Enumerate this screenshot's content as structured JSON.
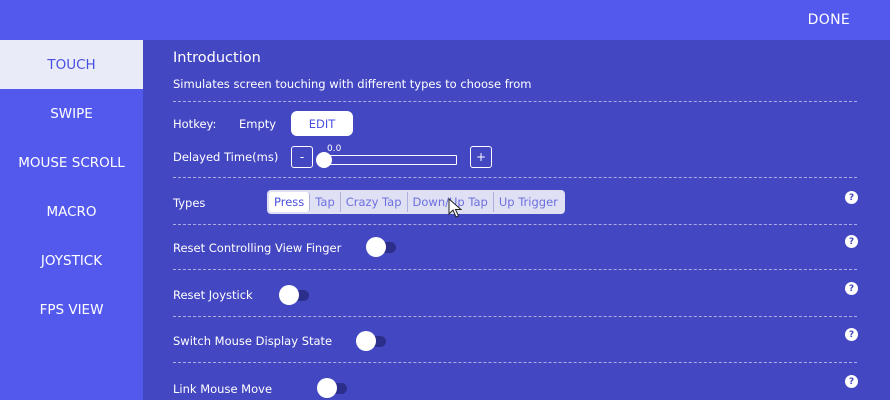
{
  "header": {
    "done_label": "DONE"
  },
  "sidebar": {
    "items": [
      {
        "label": "TOUCH",
        "active": true
      },
      {
        "label": "SWIPE"
      },
      {
        "label": "MOUSE SCROLL"
      },
      {
        "label": "MACRO"
      },
      {
        "label": "JOYSTICK"
      },
      {
        "label": "FPS VIEW"
      }
    ]
  },
  "intro": {
    "title": "Introduction",
    "description": "Simulates screen touching with different types to choose from"
  },
  "hotkey": {
    "label": "Hotkey:",
    "value": "Empty",
    "edit_label": "EDIT"
  },
  "delay": {
    "label": "Delayed Time(ms)",
    "value": "0.0",
    "minus": "-",
    "plus": "+"
  },
  "types": {
    "label": "Types",
    "options": [
      "Press",
      "Tap",
      "Crazy Tap",
      "Down/Up Tap",
      "Up Trigger"
    ],
    "selected": "Press"
  },
  "settings": [
    {
      "label": "Reset Controlling View Finger",
      "enabled": false
    },
    {
      "label": "Reset Joystick",
      "enabled": false
    },
    {
      "label": "Switch Mouse Display State",
      "enabled": false
    },
    {
      "label": "Link Mouse Move",
      "enabled": false
    }
  ],
  "help_glyph": "?",
  "colors": {
    "accent": "#5459ee",
    "panel": "#4447c2",
    "active_sidebar_bg": "#e9ecf8",
    "toggle_track": "#2b2e8a"
  }
}
